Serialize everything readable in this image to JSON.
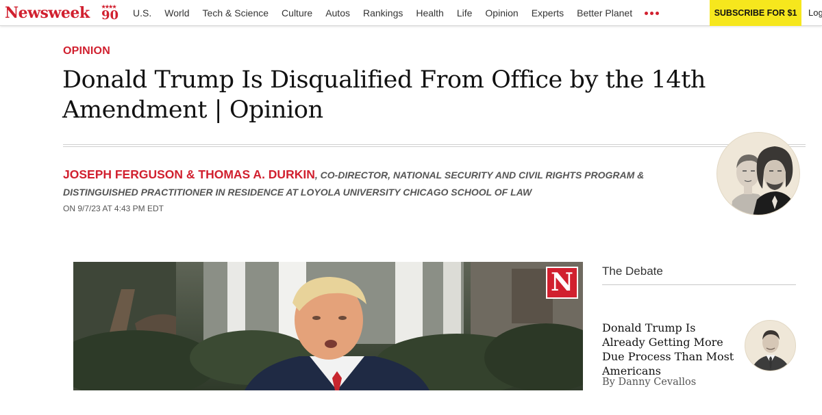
{
  "brand": {
    "logo_text": "Newsweek",
    "anniversary": "90",
    "accent_color": "#d1202f",
    "subscribe_color": "#f6e71d"
  },
  "nav": {
    "links": [
      "U.S.",
      "World",
      "Tech & Science",
      "Culture",
      "Autos",
      "Rankings",
      "Health",
      "Life",
      "Opinion",
      "Experts",
      "Better Planet"
    ],
    "more_icon": "more-dots-icon",
    "subscribe_label": "SUBSCRIBE FOR $1",
    "login_label": "Log"
  },
  "article": {
    "section": "OPINION",
    "headline": "Donald Trump Is Disqualified From Office by the 14th Amendment | Opinion",
    "authors": "JOSEPH FERGUSON & THOMAS A. DURKIN",
    "author_roles": ", CO-DIRECTOR, NATIONAL SECURITY AND CIVIL RIGHTS PROGRAM & DISTINGUISHED PRACTITIONER IN RESIDENCE AT LOYOLA UNIVERSITY CHICAGO SCHOOL OF LAW",
    "dateline": "ON 9/7/23 AT 4:43 PM EDT",
    "hero_badge": "N"
  },
  "sidebar": {
    "section_title": "The Debate",
    "related": {
      "title": "Donald Trump Is Already Getting More Due Process Than Most Americans",
      "byline": "By Danny Cevallos"
    }
  }
}
